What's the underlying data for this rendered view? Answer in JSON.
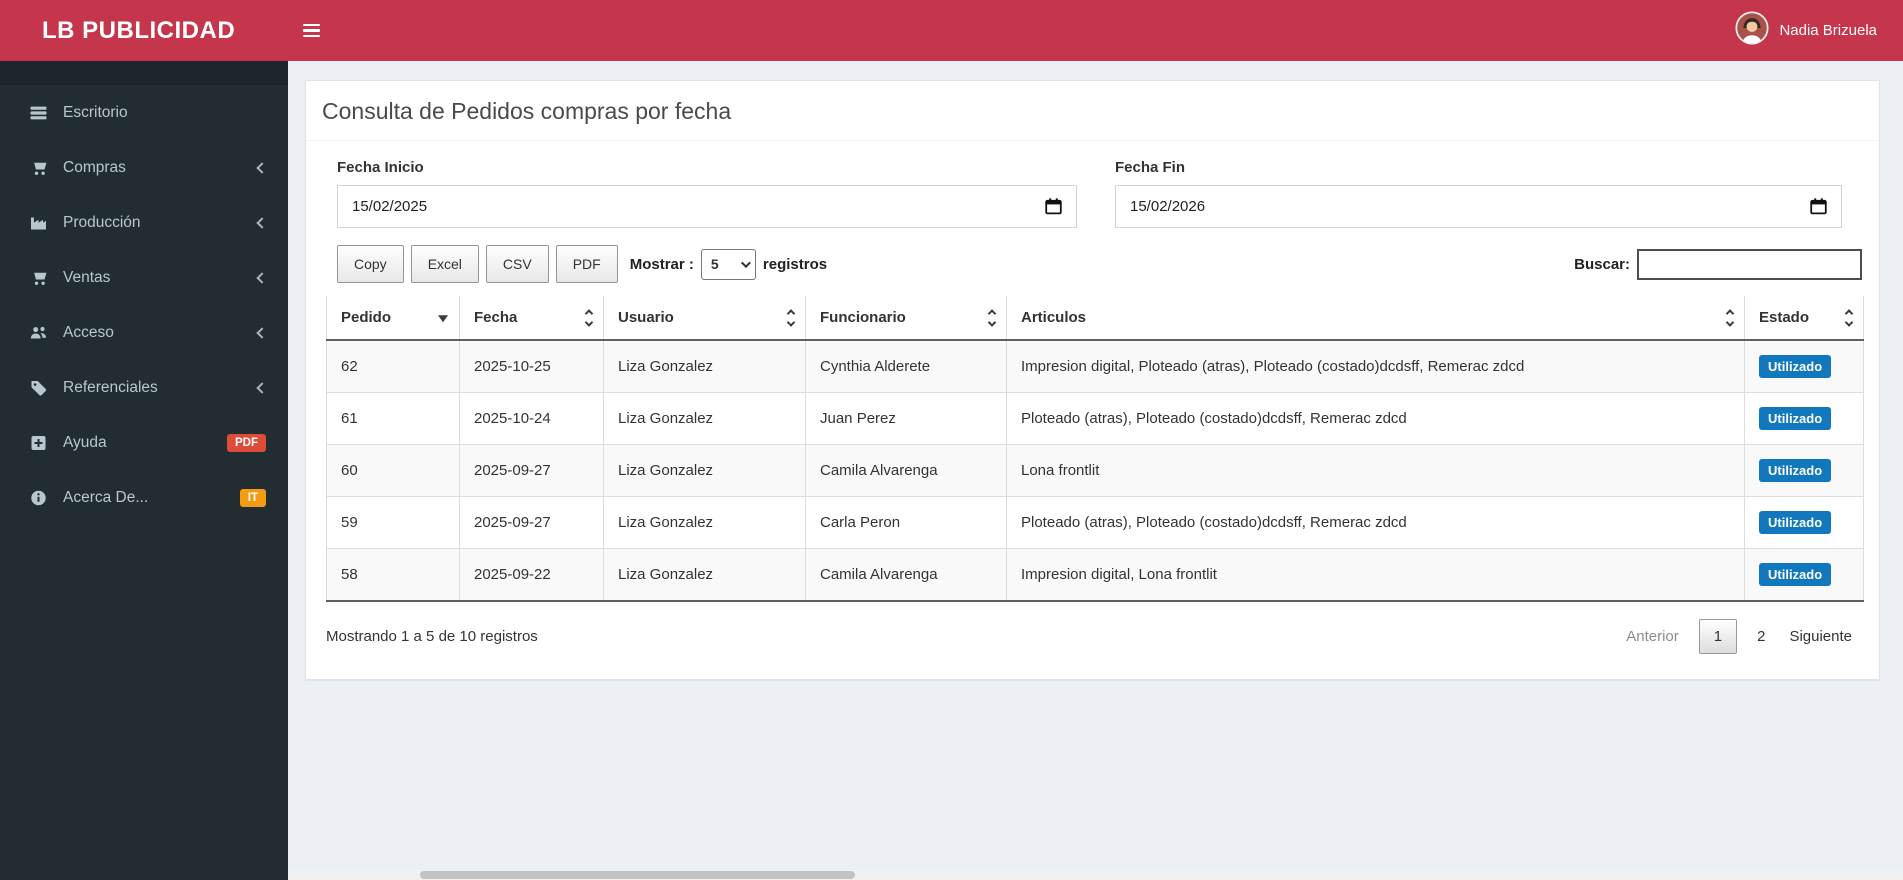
{
  "app": {
    "brand": "LB PUBLICIDAD",
    "user_name": "Nadia Brizuela"
  },
  "sidebar": {
    "items": [
      {
        "label": "Escritorio"
      },
      {
        "label": "Compras",
        "has_submenu": true
      },
      {
        "label": "Producción",
        "has_submenu": true
      },
      {
        "label": "Ventas",
        "has_submenu": true
      },
      {
        "label": "Acceso",
        "has_submenu": true
      },
      {
        "label": "Referenciales",
        "has_submenu": true
      },
      {
        "label": "Ayuda",
        "badge": "PDF",
        "badge_color": "#dd4b39"
      },
      {
        "label": "Acerca De...",
        "badge": "IT",
        "badge_color": "#f39c12"
      }
    ]
  },
  "page": {
    "title": "Consulta de Pedidos compras por fecha"
  },
  "filters": {
    "fecha_inicio": {
      "label": "Fecha Inicio",
      "value": "15/02/2025"
    },
    "fecha_fin": {
      "label": "Fecha Fin",
      "value": "15/02/2026"
    }
  },
  "toolbar": {
    "export_buttons": [
      "Copy",
      "Excel",
      "CSV",
      "PDF"
    ],
    "mostrar_label": "Mostrar :",
    "page_size": "5",
    "registros_label": "registros",
    "buscar_label": "Buscar:",
    "buscar_value": ""
  },
  "table": {
    "columns": [
      "Pedido",
      "Fecha",
      "Usuario",
      "Funcionario",
      "Articulos",
      "Estado"
    ],
    "sorted_column": "Pedido",
    "sorted_direction": "desc",
    "rows": [
      {
        "pedido": "62",
        "fecha": "2025-10-25",
        "usuario": "Liza Gonzalez",
        "funcionario": "Cynthia Alderete",
        "articulos": "Impresion digital, Ploteado (atras), Ploteado (costado)dcdsff, Remerac zdcd",
        "estado": "Utilizado"
      },
      {
        "pedido": "61",
        "fecha": "2025-10-24",
        "usuario": "Liza Gonzalez",
        "funcionario": "Juan Perez",
        "articulos": "Ploteado (atras), Ploteado (costado)dcdsff, Remerac zdcd",
        "estado": "Utilizado"
      },
      {
        "pedido": "60",
        "fecha": "2025-09-27",
        "usuario": "Liza Gonzalez",
        "funcionario": "Camila Alvarenga",
        "articulos": "Lona frontlit",
        "estado": "Utilizado"
      },
      {
        "pedido": "59",
        "fecha": "2025-09-27",
        "usuario": "Liza Gonzalez",
        "funcionario": "Carla Peron",
        "articulos": "Ploteado (atras), Ploteado (costado)dcdsff, Remerac zdcd",
        "estado": "Utilizado"
      },
      {
        "pedido": "58",
        "fecha": "2025-09-22",
        "usuario": "Liza Gonzalez",
        "funcionario": "Camila Alvarenga",
        "articulos": "Impresion digital, Lona frontlit",
        "estado": "Utilizado"
      }
    ]
  },
  "pagination": {
    "info": "Mostrando 1 a 5 de 10 registros",
    "previous_label": "Anterior",
    "pages": [
      "1",
      "2"
    ],
    "current_page": "1",
    "next_label": "Siguiente"
  },
  "colors": {
    "header": "#c5354b",
    "sidebar": "#222d32",
    "estado_badge": "#1178be",
    "badge_pdf": "#dd4b39",
    "badge_it": "#f39c12"
  }
}
